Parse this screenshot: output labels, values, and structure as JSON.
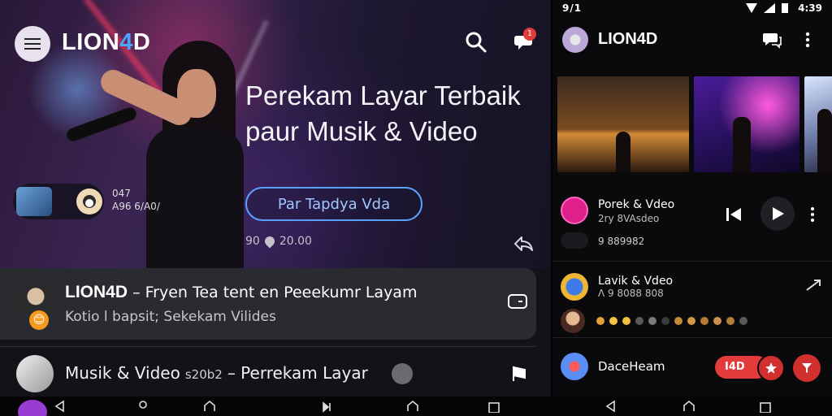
{
  "left": {
    "brand": {
      "prefix": "LION",
      "accent": "4",
      "suffix": "D"
    },
    "notification_count": "1",
    "headline": "Perekam Layar Terbaik paur Musik & Video",
    "cta_label": "Par Tapdya Vda",
    "hero_meta": {
      "left": "90",
      "right": "20.00"
    },
    "mini_player_text": [
      "047",
      "A96 6/A0/"
    ],
    "card1": {
      "title_brand": "LION4D",
      "title_rest": "– Fryen Tea tent en Peeekumr Layam",
      "subtitle": "Kotio l bapsit; Sekekam Vilides"
    },
    "card2": {
      "title": "Musik & Video",
      "small": "s20b2",
      "rest": "– Perrekam Layar"
    }
  },
  "right": {
    "status": {
      "left": "9/1",
      "time": "4:39"
    },
    "brand": "LION4D",
    "row1": {
      "title": "Porek & Vdeo",
      "sub": "2ry 8VAsdeo",
      "count": "9 889982"
    },
    "row2": {
      "title": "Lavik & Vdeo",
      "sub": "Λ 9 8088 808"
    },
    "row3": {
      "title": "DaceHeam",
      "live": "I4D"
    },
    "dot_colors": [
      "#e0a03a",
      "#f4c542",
      "#f0c040",
      "#5a5a5a",
      "#7a7a7a",
      "#3a3a3a",
      "#c88a3a",
      "#d49844",
      "#b87a34",
      "#c8904a",
      "#b0803a",
      "#5a5a5a"
    ]
  },
  "colors": {
    "accent": "#4fa3ff",
    "live": "#e33a3a"
  }
}
